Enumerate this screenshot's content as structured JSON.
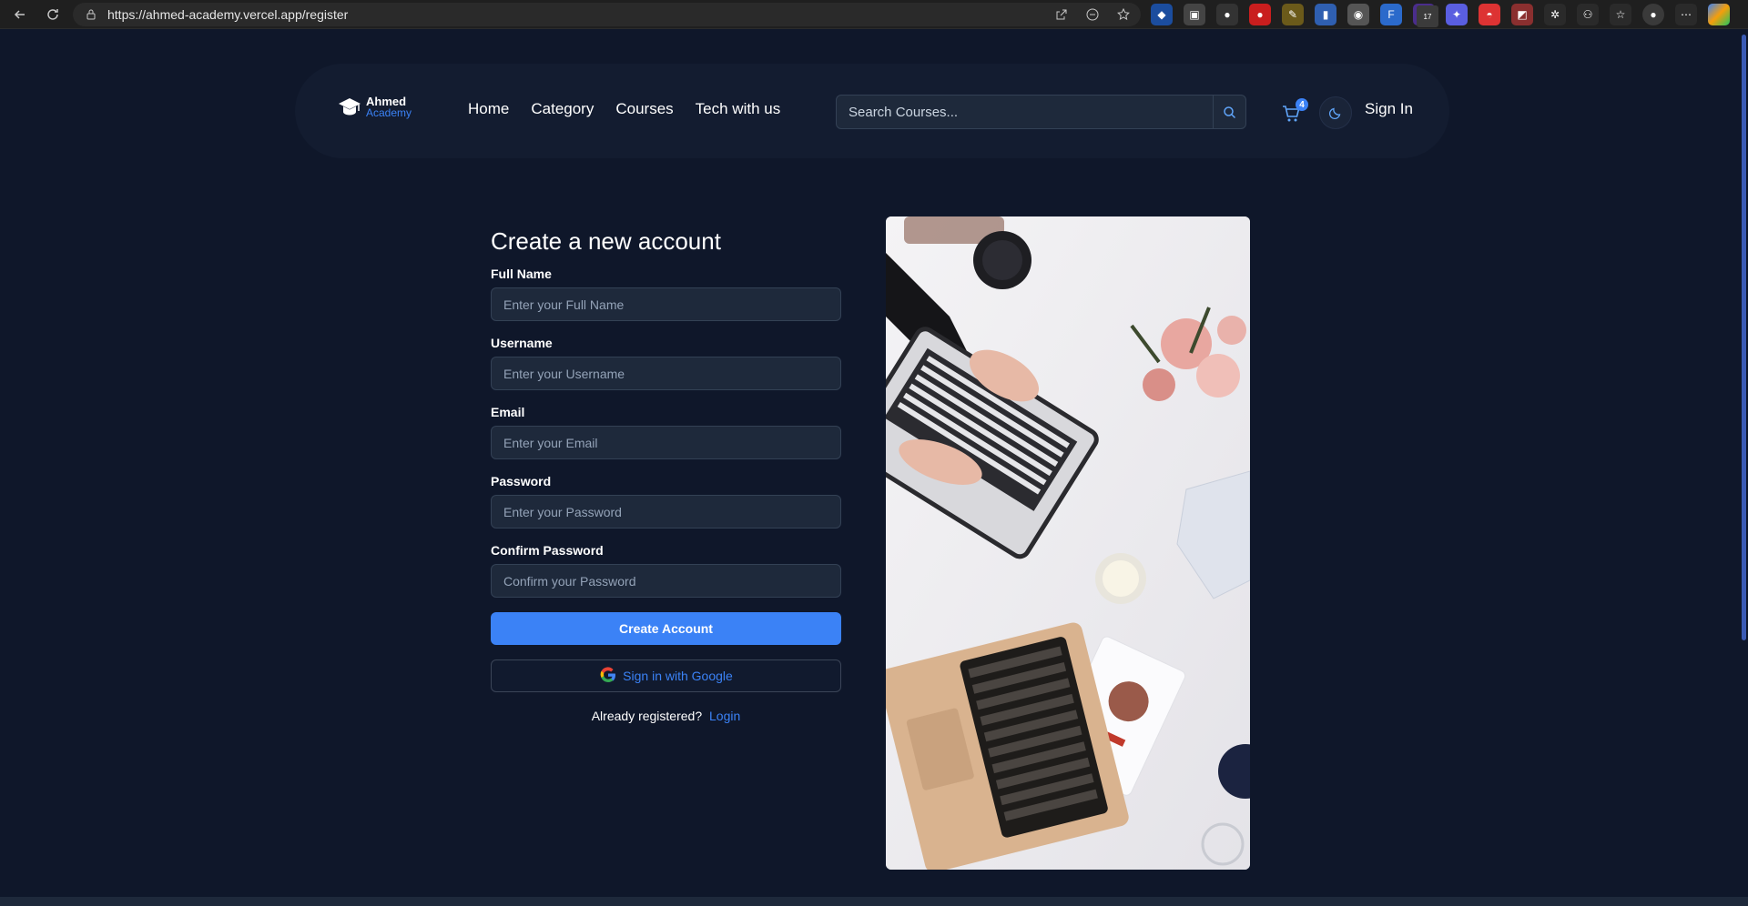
{
  "browser": {
    "url": "https://ahmed-academy.vercel.app/register",
    "extension_badge": "17"
  },
  "brand": {
    "name_line1": "Ahmed",
    "name_line2": "Academy",
    "accent": "#3b82f6"
  },
  "nav": {
    "links": [
      "Home",
      "Category",
      "Courses",
      "Tech with us"
    ],
    "search_placeholder": "Search Courses...",
    "cart_count": "4",
    "sign_in": "Sign In"
  },
  "form": {
    "title": "Create a new account",
    "fields": [
      {
        "label": "Full Name",
        "placeholder": "Enter your Full Name"
      },
      {
        "label": "Username",
        "placeholder": "Enter your Username"
      },
      {
        "label": "Email",
        "placeholder": "Enter your Email"
      },
      {
        "label": "Password",
        "placeholder": "Enter your Password"
      },
      {
        "label": "Confirm Password",
        "placeholder": "Confirm your Password"
      }
    ],
    "submit_label": "Create Account",
    "google_label": "Sign in with Google",
    "already_text": "Already registered?",
    "login_link": "Login"
  },
  "icons": {
    "back": "arrow-left-icon",
    "reload": "reload-icon",
    "lock": "lock-icon",
    "logo": "graduation-cap-icon",
    "search": "search-icon",
    "cart": "cart-icon",
    "theme": "moon-icon",
    "google": "google-icon"
  },
  "colors": {
    "background": "#0f172a",
    "navbar": "#131c30",
    "input_bg": "#1e293b",
    "primary_button": "#3b82f6"
  }
}
